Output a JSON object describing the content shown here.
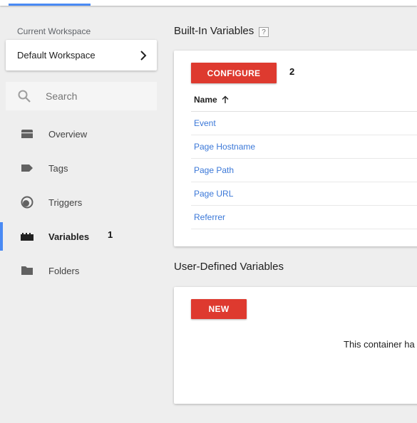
{
  "sidebar": {
    "workspace_label": "Current Workspace",
    "workspace_name": "Default Workspace",
    "search_placeholder": "Search",
    "items": [
      {
        "label": "Overview",
        "icon": "overview-icon"
      },
      {
        "label": "Tags",
        "icon": "tag-icon"
      },
      {
        "label": "Triggers",
        "icon": "trigger-icon"
      },
      {
        "label": "Variables",
        "icon": "variables-icon",
        "active": true
      },
      {
        "label": "Folders",
        "icon": "folder-icon"
      }
    ]
  },
  "annotations": {
    "variables_marker": "1",
    "configure_marker": "2"
  },
  "builtin": {
    "title": "Built-In Variables",
    "help": "?",
    "configure_label": "CONFIGURE",
    "column_name": "Name",
    "rows": [
      "Event",
      "Page Hostname",
      "Page Path",
      "Page URL",
      "Referrer"
    ]
  },
  "user_defined": {
    "title": "User-Defined Variables",
    "new_label": "NEW",
    "empty_text": "This container ha"
  },
  "colors": {
    "accent": "#4a8af4",
    "button_red": "#de3a2f",
    "link": "#3b78d8"
  }
}
